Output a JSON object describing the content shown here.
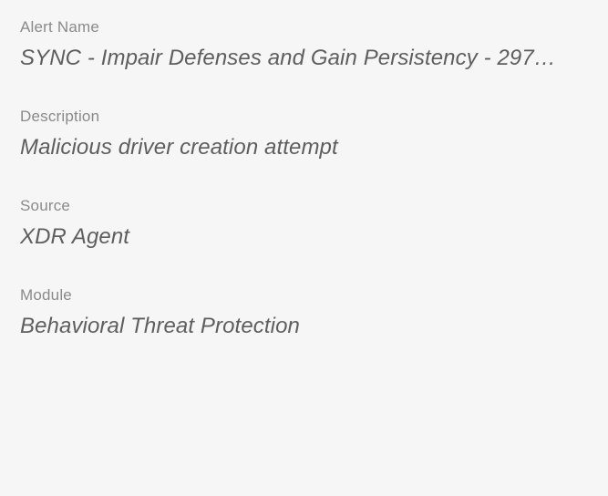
{
  "fields": [
    {
      "label": "Alert Name",
      "value": "SYNC - Impair Defenses and Gain Persistency - 297…"
    },
    {
      "label": "Description",
      "value": "Malicious driver creation attempt"
    },
    {
      "label": "Source",
      "value": "XDR Agent"
    },
    {
      "label": "Module",
      "value": "Behavioral Threat Protection"
    }
  ]
}
